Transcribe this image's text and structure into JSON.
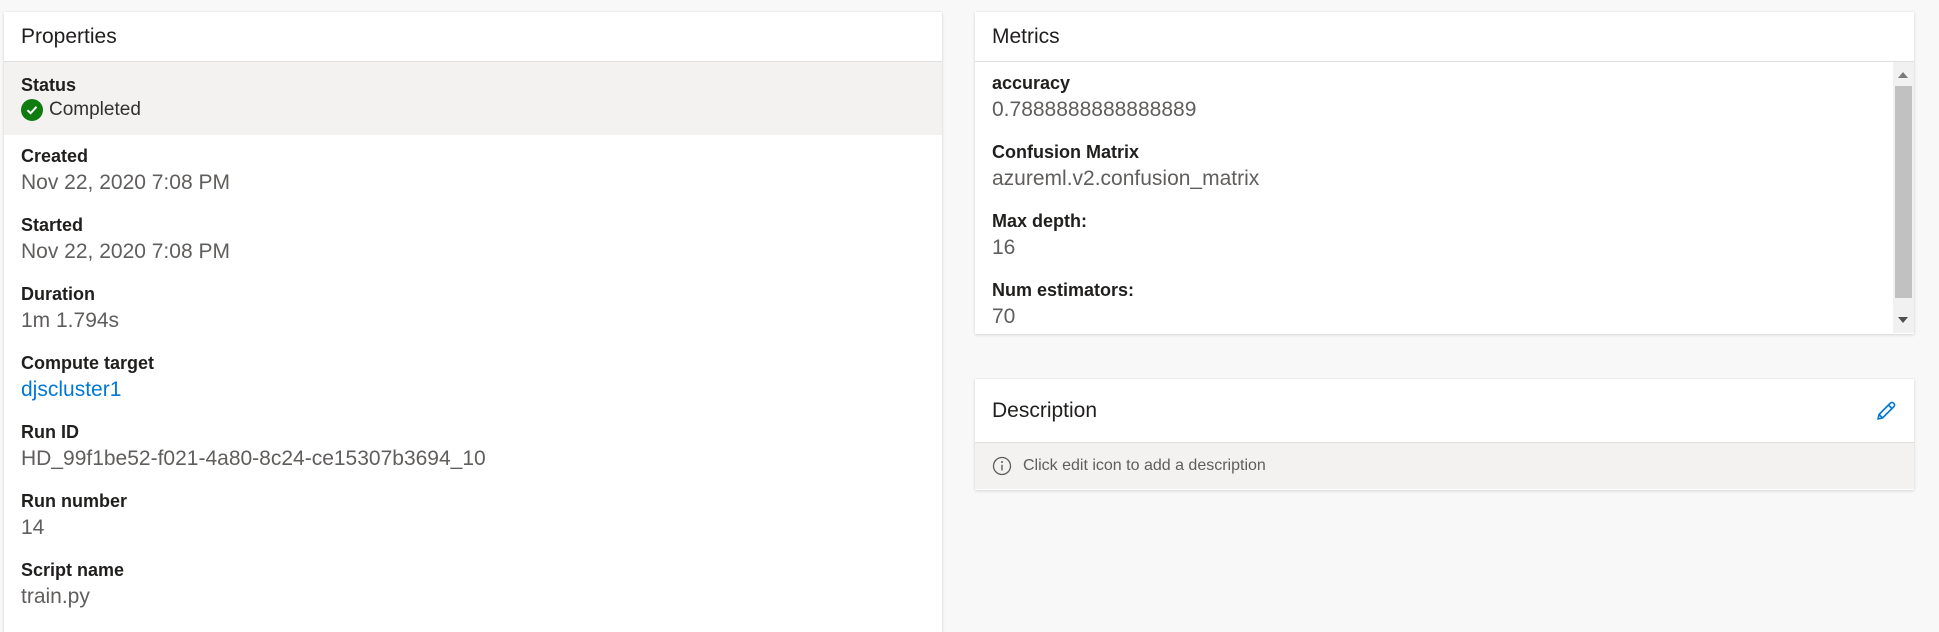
{
  "properties": {
    "title": "Properties",
    "status": {
      "label": "Status",
      "value": "Completed"
    },
    "created": {
      "label": "Created",
      "value": "Nov 22, 2020 7:08 PM"
    },
    "started": {
      "label": "Started",
      "value": "Nov 22, 2020 7:08 PM"
    },
    "duration": {
      "label": "Duration",
      "value": "1m 1.794s"
    },
    "compute_target": {
      "label": "Compute target",
      "value": "djscluster1"
    },
    "run_id": {
      "label": "Run ID",
      "value": "HD_99f1be52-f021-4a80-8c24-ce15307b3694_10"
    },
    "run_number": {
      "label": "Run number",
      "value": "14"
    },
    "script_name": {
      "label": "Script name",
      "value": "train.py"
    }
  },
  "metrics": {
    "title": "Metrics",
    "items": [
      {
        "label": "accuracy",
        "value": "0.7888888888888889"
      },
      {
        "label": "Confusion Matrix",
        "value": "azureml.v2.confusion_matrix"
      },
      {
        "label": "Max depth:",
        "value": "16"
      },
      {
        "label": "Num estimators:",
        "value": "70"
      }
    ]
  },
  "description": {
    "title": "Description",
    "placeholder": "Click edit icon to add a description"
  },
  "icons": {
    "status": "check-circle-icon",
    "edit": "pencil-icon",
    "info": "info-icon"
  },
  "colors": {
    "success": "#107c10",
    "link": "#0078d4"
  }
}
